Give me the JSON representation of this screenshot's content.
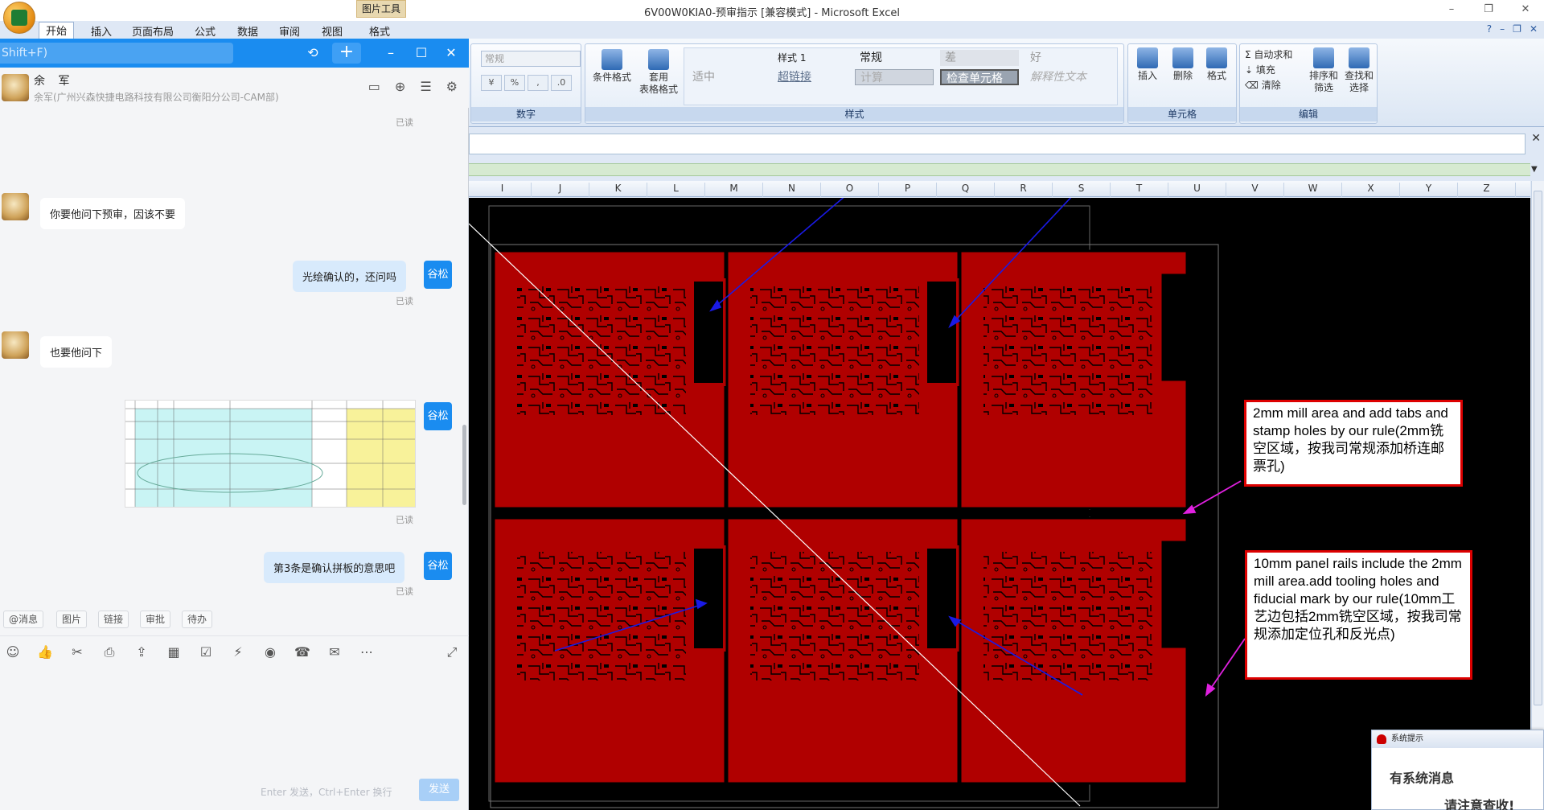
{
  "excel": {
    "window_title": "6V00W0KIA0-预审指示  [兼容模式] - Microsoft Excel",
    "picture_tools_label": "图片工具",
    "tabs": [
      "开始",
      "插入",
      "页面布局",
      "公式",
      "数据",
      "审阅",
      "视图",
      "格式"
    ],
    "active_tab": "开始",
    "ribbon": {
      "number_format_value": "常规",
      "groups": {
        "number": "数字",
        "styles": "样式",
        "cells": "单元格",
        "editing": "编辑"
      },
      "buttons": {
        "conditional_format": "条件格式",
        "table_format_1": "套用",
        "table_format_2": "表格格式",
        "insert": "插入",
        "delete": "删除",
        "format": "格式",
        "autosum": "自动求和",
        "fill": "填充",
        "clear": "清除",
        "sort_filter_1": "排序和",
        "sort_filter_2": "筛选",
        "find_select_1": "查找和",
        "find_select_2": "选择"
      },
      "cell_styles": {
        "style1": "样式 1",
        "normal": "常规",
        "bad": "差",
        "good": "好",
        "neutral": "适中",
        "hyperlink": "超链接",
        "calculation": "计算",
        "check_cell": "检查单元格",
        "explanatory": "解释性文本"
      }
    },
    "columns": [
      "I",
      "J",
      "K",
      "L",
      "M",
      "N",
      "O",
      "P",
      "Q",
      "R",
      "S",
      "T",
      "U",
      "V",
      "W",
      "X",
      "Y",
      "Z"
    ],
    "callouts": {
      "top": "2mm mill area and add tabs and stamp holes by our rule(2mm铣空区域，按我司常规添加桥连邮票孔)",
      "bottom": "10mm panel rails include the 2mm mill area.add tooling holes and fiducial mark by our rule(10mm工艺边包括2mm铣空区域，按我司常规添加定位孔和反光点)"
    },
    "colors": {
      "pcb_red": "#b00000",
      "callout_border": "#dd0000",
      "arrow_blue": "#1a1ae6",
      "arrow_magenta": "#e020e0"
    },
    "system_notice": {
      "title": "系统提示",
      "line1": "有系统消息",
      "line2": "请注意查收!"
    }
  },
  "chat": {
    "search_placeholder": "Shift+F)",
    "contact_name": "余 军",
    "contact_sub": "余军(广州兴森快捷电路科技有限公司衡阳分公司-CAM部)",
    "messages": [
      {
        "side": "left",
        "text": "你要他问下预审，因该不要"
      },
      {
        "side": "right",
        "text": "光绘确认的，还问吗"
      },
      {
        "side": "left",
        "text": "也要他问下"
      },
      {
        "side": "right",
        "text": "第3条是确认拼板的意思吧"
      }
    ],
    "me_label": "谷松",
    "read_label": "已读",
    "quick_replies": [
      "@消息",
      "图片",
      "链接",
      "审批",
      "待办"
    ],
    "input_hint": "Enter 发送，Ctrl+Enter 换行",
    "send_label": "发送"
  }
}
